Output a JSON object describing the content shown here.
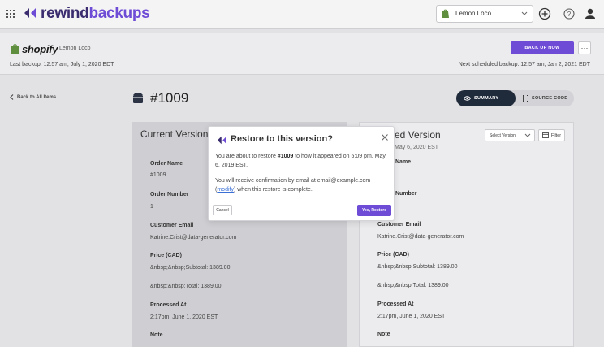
{
  "brand": {
    "name_part1": "rewind",
    "name_part2": "backups"
  },
  "store_selector": {
    "value": "Lemon Loco"
  },
  "store_header": {
    "platform": "shopify",
    "store_name": "Lemon Loco",
    "last_backup": "Last backup: 12:57 am, July 1, 2020 EDT",
    "next_backup": "Next scheduled backup: 12:57 am, Jan 2, 2021 EDT",
    "backup_now_label": "BACK UP NOW",
    "more_label": "···"
  },
  "back_link": "Back to All Items",
  "order_number": "#1009",
  "view_toggle": {
    "summary": "SUMMARY",
    "source_code": "SOURCE CODE"
  },
  "current_version": {
    "title": "Current Version",
    "fields": [
      {
        "label": "Order Name",
        "value": "#1009"
      },
      {
        "label": "Order Number",
        "value": "1"
      },
      {
        "label": "Customer Email",
        "value": "Katrine.Crist@data-generator.com"
      },
      {
        "label": "Price (CAD)",
        "value": "&nbsp;&nbsp;Subtotal: 1389.00"
      },
      {
        "label": "",
        "value": "&nbsp;&nbsp;Total: 1389.00"
      },
      {
        "label": "Processed At",
        "value": "2:17pm, June 1, 2020 EST"
      },
      {
        "label": "Note",
        "value": ""
      }
    ]
  },
  "selected_version": {
    "title": "ed Version",
    "subtitle": "May 6, 2020 EST",
    "select_label": "Select Version",
    "filter_label": "Filter",
    "fields": [
      {
        "label": "Name",
        "value": ""
      },
      {
        "label": "Number",
        "value": ""
      },
      {
        "label": "Customer Email",
        "value": "Katrine.Crist@data-generator.com"
      },
      {
        "label": "Price (CAD)",
        "value": "&nbsp;&nbsp;Subtotal: 1389.00"
      },
      {
        "label": "",
        "value": "&nbsp;&nbsp;Total: 1389.00"
      },
      {
        "label": "Processed At",
        "value": "2:17pm, June 1, 2020 EST"
      },
      {
        "label": "Note",
        "value": ""
      }
    ]
  },
  "modal": {
    "title": "Restore to this version?",
    "line1_pre": "You are about to restore ",
    "line1_bold": "#1009",
    "line1_post": " to how it appeared on 5:09 pm, May 6, 2019 EST.",
    "line2_pre": "You will receive confirmation by email at email@example.com (",
    "line2_link": "modify",
    "line2_post": ") when this restore is complete.",
    "cancel_label": "Cancel",
    "confirm_label": "Yes, Restore"
  },
  "colors": {
    "accent": "#6f4cd6",
    "brand_dark": "#3a2c6e",
    "toggle_active": "#1f2a3a",
    "link": "#3a6fd6"
  },
  "icons": [
    "apps-grid-icon",
    "rewind-logo-icon",
    "shopify-bag-icon",
    "chevron-down-icon",
    "add-circle-icon",
    "help-icon",
    "user-icon",
    "chevron-left-icon",
    "box-icon",
    "eye-icon",
    "code-icon",
    "calendar-icon",
    "close-icon"
  ]
}
